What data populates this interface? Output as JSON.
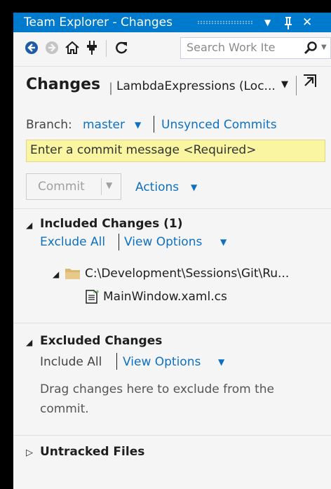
{
  "window": {
    "title": "Team Explorer - Changes",
    "dropdown_icon": "▼",
    "pin_icon": "pin-icon",
    "close_icon": "✕"
  },
  "toolbar": {
    "search_placeholder": "Search Work Ite",
    "icons": [
      "back-icon",
      "forward-icon",
      "home-icon",
      "connect-icon",
      "refresh-icon",
      "search-icon"
    ]
  },
  "header": {
    "title": "Changes",
    "divider": "|",
    "repo": "LambdaExpressions (Loc..."
  },
  "branch": {
    "label": "Branch:",
    "name": "master",
    "unsynced": "Unsynced Commits"
  },
  "commit": {
    "message_placeholder": "Enter a commit message <Required>",
    "button": "Commit",
    "actions": "Actions"
  },
  "included": {
    "title": "Included Changes (1)",
    "exclude_all": "Exclude All",
    "view_options": "View Options",
    "folder_path": "C:\\Development\\Sessions\\Git\\Ru...",
    "file": "MainWindow.xaml.cs"
  },
  "excluded": {
    "title": "Excluded Changes",
    "include_all": "Include All",
    "view_options": "View Options",
    "hint": "Drag changes here to exclude from the",
    "hint_line2": "commit."
  },
  "untracked": {
    "title": "Untracked Files"
  },
  "colors": {
    "accent": "#007acc",
    "link": "#0e70c0",
    "commit_box": "#faf5a0"
  }
}
